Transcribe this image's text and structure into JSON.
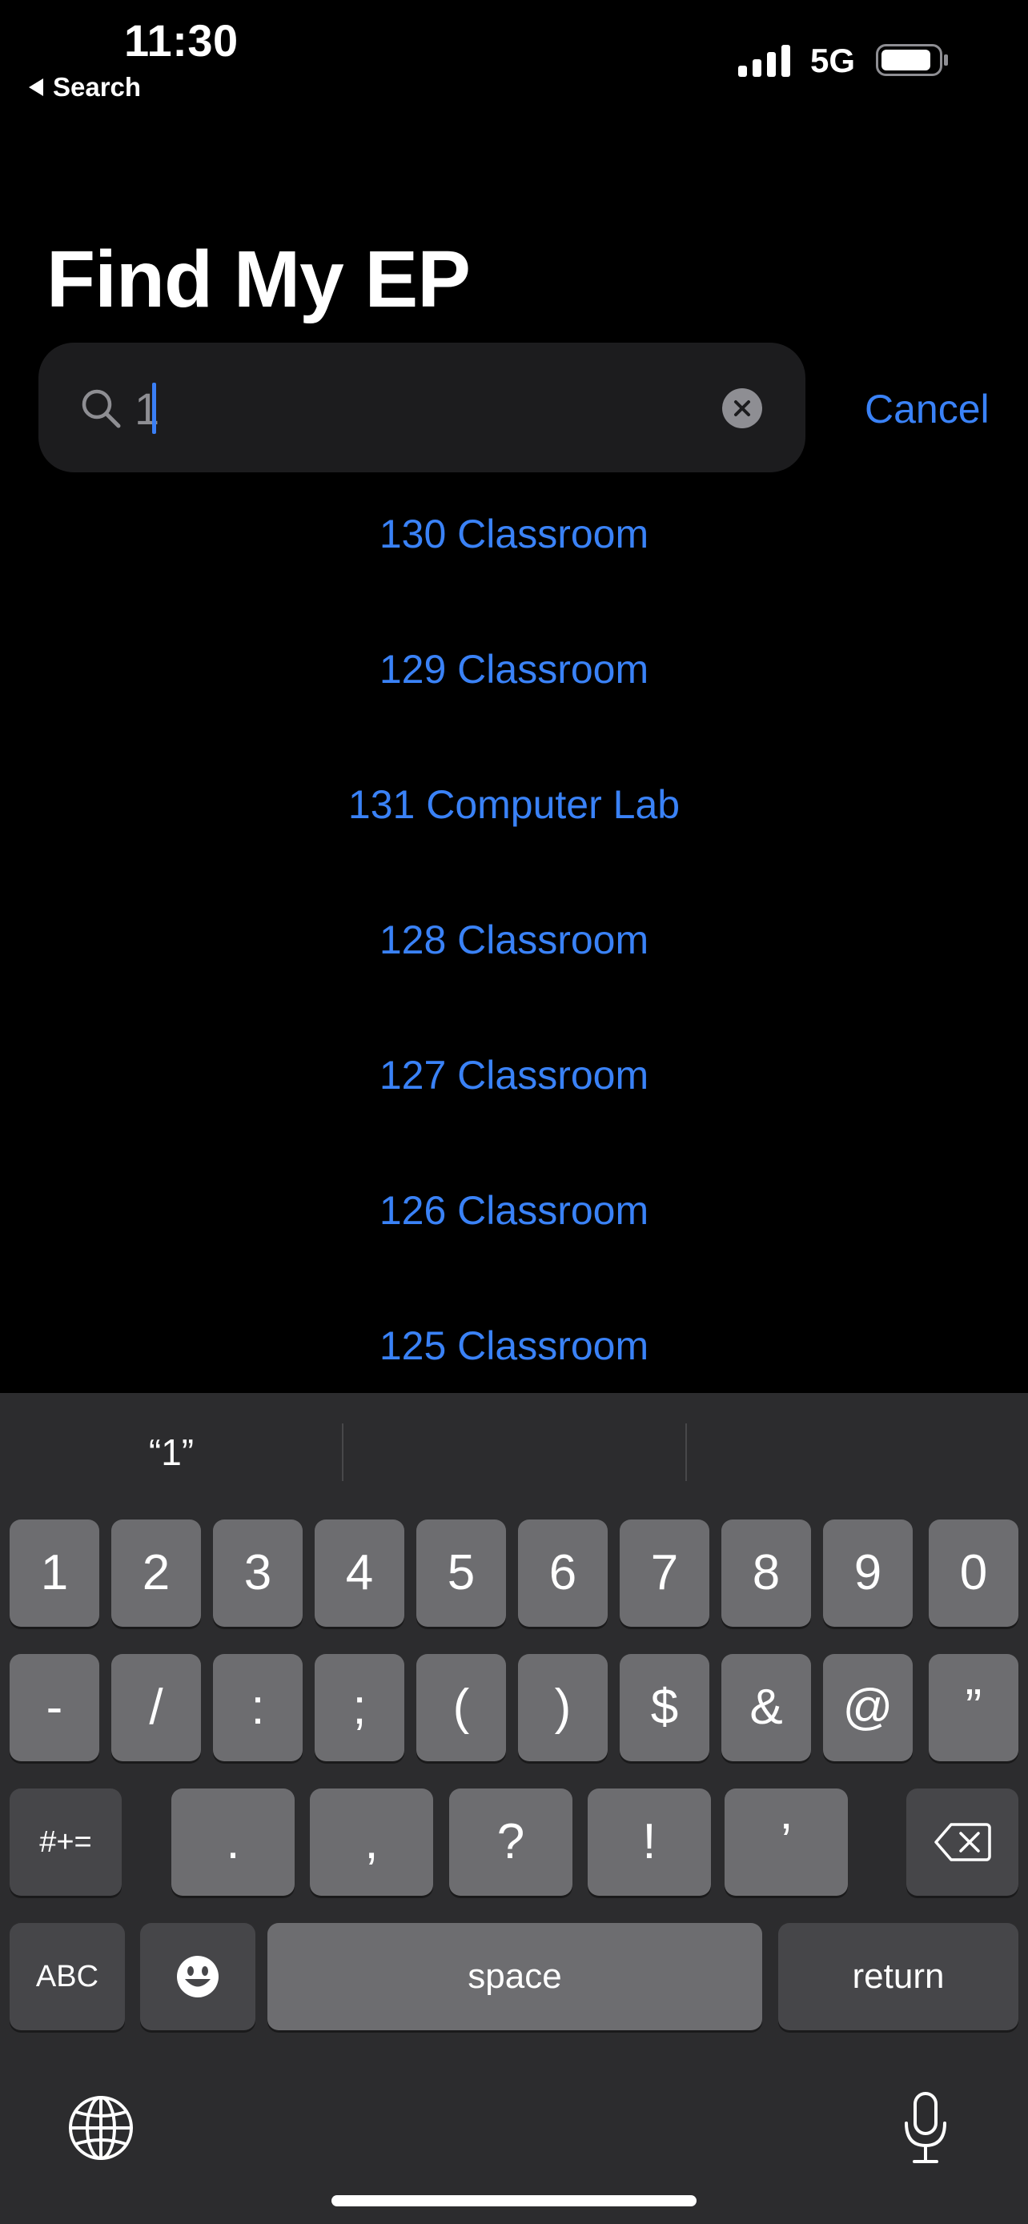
{
  "status_bar": {
    "time": "11:30",
    "back_label": "Search",
    "network": "5G",
    "signal_icon": "cellular-signal-icon",
    "battery_icon": "battery-icon"
  },
  "page": {
    "title": "Find My EP"
  },
  "search": {
    "value": "1",
    "clear_icon": "clear-icon",
    "cancel_label": "Cancel"
  },
  "results": [
    "130 Classroom",
    "129 Classroom",
    "131 Computer Lab",
    "128 Classroom",
    "127 Classroom",
    "126 Classroom",
    "125 Classroom"
  ],
  "keyboard": {
    "suggestions": [
      "“1”",
      "",
      ""
    ],
    "row1": [
      "1",
      "2",
      "3",
      "4",
      "5",
      "6",
      "7",
      "8",
      "9",
      "0"
    ],
    "row2": [
      "-",
      "/",
      ":",
      ";",
      "(",
      ")",
      "$",
      "&",
      "@",
      "”"
    ],
    "row3": [
      ".",
      ",",
      "?",
      "!",
      "’"
    ],
    "symbols_label": "#+=",
    "abc_label": "ABC",
    "space_label": "space",
    "return_label": "return",
    "globe_icon": "globe-icon",
    "mic_icon": "microphone-icon",
    "emoji_icon": "emoji-icon",
    "delete_icon": "delete-icon"
  },
  "colors": {
    "accent": "#3a82f7",
    "background": "#000000",
    "keyboard_bg": "#2c2c2e",
    "key": "#6d6d70",
    "key_dark": "#464649"
  }
}
